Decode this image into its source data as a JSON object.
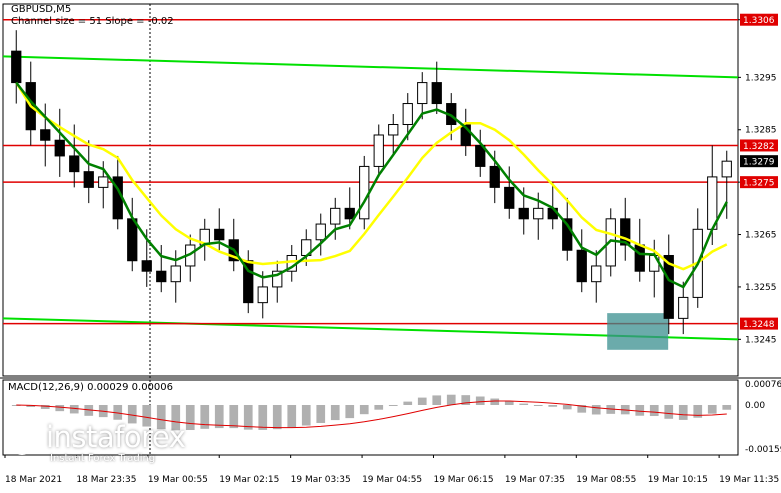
{
  "chart_data": {
    "type": "candlestick",
    "symbol_label": "GBPUSD,M5",
    "indicator_label": "Channel size = 51 Slope = -0.02",
    "macd_label": "MACD(12,26,9) 0.00029 0.00006",
    "y_ticks": [
      1.3306,
      1.3295,
      1.3285,
      1.3275,
      1.3265,
      1.3255,
      1.3245
    ],
    "y_tick_labels": [
      "1.3306",
      "1.3295",
      "1.3285",
      "1.3275",
      "1.3265",
      "1.3255",
      "1.3245"
    ],
    "ylim": [
      1.3238,
      1.3309
    ],
    "x_labels": [
      "18 Mar 2021",
      "18 Mar 23:35",
      "19 Mar 00:55",
      "19 Mar 02:15",
      "19 Mar 03:35",
      "19 Mar 04:55",
      "19 Mar 06:15",
      "19 Mar 07:35",
      "19 Mar 08:55",
      "19 Mar 10:15",
      "19 Mar 11:35"
    ],
    "horizontal_levels": [
      {
        "value": 1.3306,
        "label": "1.3306",
        "color": "#e00000"
      },
      {
        "value": 1.3282,
        "label": "1.3282",
        "color": "#e00000"
      },
      {
        "value": 1.3275,
        "label": "1.3275",
        "color": "#e00000"
      },
      {
        "value": 1.3248,
        "label": "1.3248",
        "color": "#e00000"
      }
    ],
    "current_price": {
      "value": 1.3279,
      "label": "1.3279"
    },
    "macd_ticks": [
      0.00076,
      0.0,
      -0.00159
    ],
    "macd_tick_labels": [
      "0.00076",
      "0.00",
      "-0.00159"
    ],
    "macd_ylim": [
      -0.0018,
      0.0009
    ],
    "highlight_box": {
      "x_from": 0.822,
      "x_to": 0.905,
      "y_from": 1.3243,
      "y_to": 1.325,
      "color": "#3a8f8f"
    },
    "series": [
      {
        "kind": "channel_upper",
        "color": "#00e000",
        "points": [
          [
            0.0,
            1.3299
          ],
          [
            1.0,
            1.3295
          ]
        ]
      },
      {
        "kind": "channel_lower",
        "color": "#00e000",
        "points": [
          [
            0.0,
            1.3249
          ],
          [
            1.0,
            1.3245
          ]
        ]
      },
      {
        "kind": "ma_slow",
        "color": "#ffff00"
      },
      {
        "kind": "ma_fast",
        "color": "#008000"
      }
    ],
    "candles": [
      [
        1.33,
        1.3304,
        1.329,
        1.3294
      ],
      [
        1.3294,
        1.3298,
        1.3282,
        1.3285
      ],
      [
        1.3285,
        1.329,
        1.3278,
        1.3283
      ],
      [
        1.3283,
        1.3289,
        1.3276,
        1.328
      ],
      [
        1.328,
        1.3286,
        1.3274,
        1.3277
      ],
      [
        1.3277,
        1.3283,
        1.3271,
        1.3274
      ],
      [
        1.3274,
        1.3279,
        1.327,
        1.3276
      ],
      [
        1.3276,
        1.328,
        1.3266,
        1.3268
      ],
      [
        1.3268,
        1.3272,
        1.3258,
        1.326
      ],
      [
        1.326,
        1.3266,
        1.3255,
        1.3258
      ],
      [
        1.3258,
        1.3263,
        1.3254,
        1.3256
      ],
      [
        1.3256,
        1.3262,
        1.3252,
        1.3259
      ],
      [
        1.3259,
        1.3265,
        1.3256,
        1.3263
      ],
      [
        1.3263,
        1.3268,
        1.326,
        1.3266
      ],
      [
        1.3266,
        1.327,
        1.3262,
        1.3264
      ],
      [
        1.3264,
        1.3268,
        1.3258,
        1.326
      ],
      [
        1.326,
        1.3262,
        1.325,
        1.3252
      ],
      [
        1.3252,
        1.3258,
        1.3249,
        1.3255
      ],
      [
        1.3255,
        1.326,
        1.3252,
        1.3258
      ],
      [
        1.3258,
        1.3263,
        1.3256,
        1.3261
      ],
      [
        1.3261,
        1.3266,
        1.3259,
        1.3264
      ],
      [
        1.3264,
        1.3269,
        1.3261,
        1.3267
      ],
      [
        1.3267,
        1.3272,
        1.3264,
        1.327
      ],
      [
        1.327,
        1.3274,
        1.3266,
        1.3268
      ],
      [
        1.3268,
        1.328,
        1.3266,
        1.3278
      ],
      [
        1.3278,
        1.3286,
        1.3276,
        1.3284
      ],
      [
        1.3284,
        1.3288,
        1.328,
        1.3286
      ],
      [
        1.3286,
        1.3292,
        1.3283,
        1.329
      ],
      [
        1.329,
        1.3296,
        1.3287,
        1.3294
      ],
      [
        1.3294,
        1.3298,
        1.3288,
        1.329
      ],
      [
        1.329,
        1.3292,
        1.3283,
        1.3286
      ],
      [
        1.3286,
        1.3289,
        1.328,
        1.3282
      ],
      [
        1.3282,
        1.3285,
        1.3276,
        1.3278
      ],
      [
        1.3278,
        1.3281,
        1.3271,
        1.3274
      ],
      [
        1.3274,
        1.3278,
        1.3268,
        1.327
      ],
      [
        1.327,
        1.3274,
        1.3265,
        1.3268
      ],
      [
        1.3268,
        1.3273,
        1.3264,
        1.327
      ],
      [
        1.327,
        1.3275,
        1.3266,
        1.3268
      ],
      [
        1.3268,
        1.3272,
        1.326,
        1.3262
      ],
      [
        1.3262,
        1.3266,
        1.3254,
        1.3256
      ],
      [
        1.3256,
        1.3262,
        1.3252,
        1.3259
      ],
      [
        1.3259,
        1.327,
        1.3257,
        1.3268
      ],
      [
        1.3268,
        1.3272,
        1.326,
        1.3263
      ],
      [
        1.3263,
        1.3268,
        1.3256,
        1.3258
      ],
      [
        1.3258,
        1.3264,
        1.3253,
        1.3261
      ],
      [
        1.3261,
        1.3265,
        1.3246,
        1.3249
      ],
      [
        1.3249,
        1.3256,
        1.3246,
        1.3253
      ],
      [
        1.3253,
        1.327,
        1.3251,
        1.3266
      ],
      [
        1.3266,
        1.3282,
        1.3263,
        1.3276
      ],
      [
        1.3276,
        1.3281,
        1.3268,
        1.3279
      ]
    ]
  }
}
